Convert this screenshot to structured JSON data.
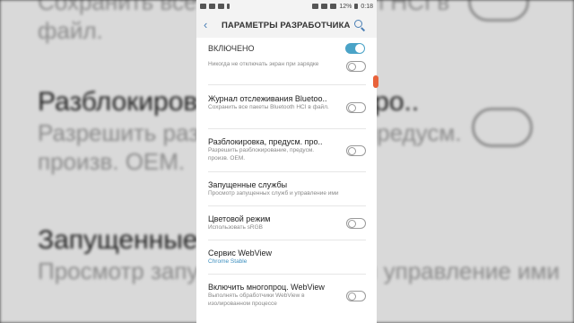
{
  "background": {
    "item1_sub": "файл.",
    "item1_sub_top": "Сохранить все пакеты Bluetooth HCI в",
    "item2_title": "Разблокировка, предусм. про..",
    "item2_sub1": "Разрешить разблокирование, предусм.",
    "item2_sub2": "произв. OEM.",
    "item3_title": "Запущенные службы",
    "item3_sub": "Просмотр запущенных служб и управление ими"
  },
  "statusbar": {
    "battery": "12%",
    "time": "0:18"
  },
  "appbar": {
    "back": "‹",
    "title": "ПАРАМЕТРЫ РАЗРАБОТЧИКА"
  },
  "master": {
    "label": "ВКЛЮЧЕНО",
    "enabled": true
  },
  "rows": [
    {
      "title": "",
      "sub": "Никогда не отключать экран при зарядке",
      "toggle": false
    },
    {
      "title": "Журнал отслеживания Bluetoo..",
      "sub": "Сохранить все пакеты Bluetooth HCI в файл.",
      "toggle": false
    },
    {
      "title": "Разблокировка, предусм. про..",
      "sub": "Разрешить разблокирование, предусм. произв. OEM.",
      "toggle": false
    },
    {
      "title": "Запущенные службы",
      "sub": "Просмотр запущенных служб и управление ими"
    },
    {
      "title": "Цветовой режим",
      "sub": "Использовать sRGB",
      "toggle": false
    },
    {
      "title": "Сервис WebView",
      "sub": "Chrome Stable"
    },
    {
      "title": "Включить многопроц. WebView",
      "sub": "Выполнять обработчики WebView в изолированном процессе",
      "toggle": false
    }
  ]
}
